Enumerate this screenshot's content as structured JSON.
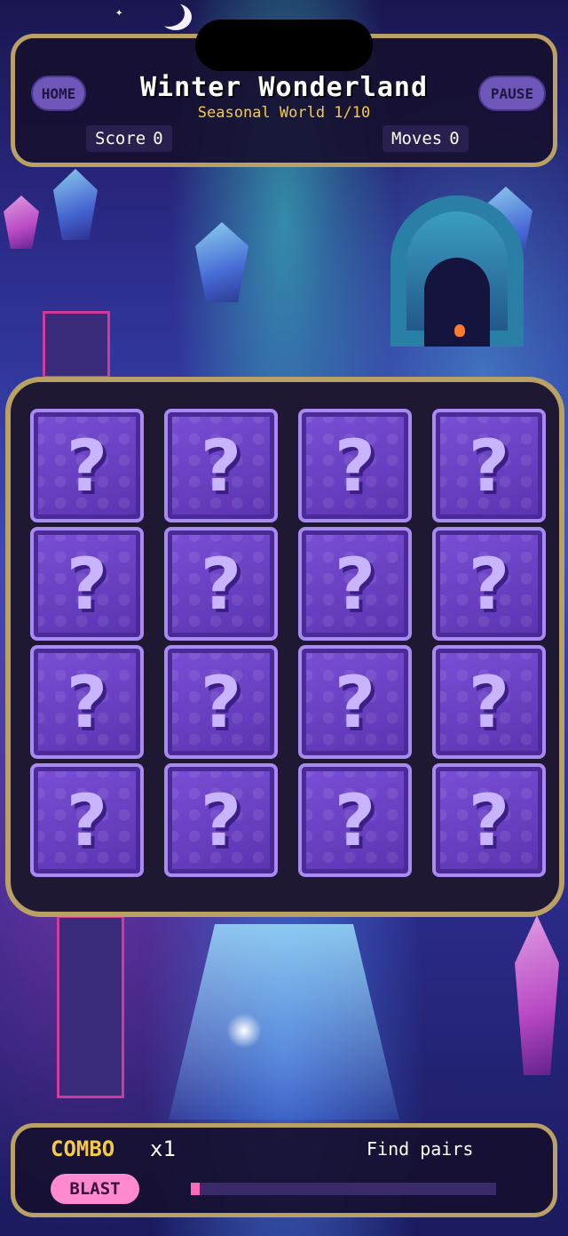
{
  "header": {
    "home_label": "HOME",
    "pause_label": "PAUSE",
    "title": "Winter Wonderland",
    "subtitle": "Seasonal World 1/10",
    "score_label": "Score",
    "score_value": "0",
    "moves_label": "Moves",
    "moves_value": "0"
  },
  "board": {
    "cards": [
      "?",
      "?",
      "?",
      "?",
      "?",
      "?",
      "?",
      "?",
      "?",
      "?",
      "?",
      "?",
      "?",
      "?",
      "?",
      "?"
    ]
  },
  "footer": {
    "combo_label": "COMBO",
    "combo_multiplier": "x1",
    "hint": "Find pairs",
    "blast_label": "BLAST",
    "blast_progress": 0.03
  },
  "colors": {
    "frame_gold": "#b9a064",
    "card_purple": "#6a3fc6",
    "combo_yellow": "#f5c94a",
    "blast_pink": "#ff8ad0"
  }
}
